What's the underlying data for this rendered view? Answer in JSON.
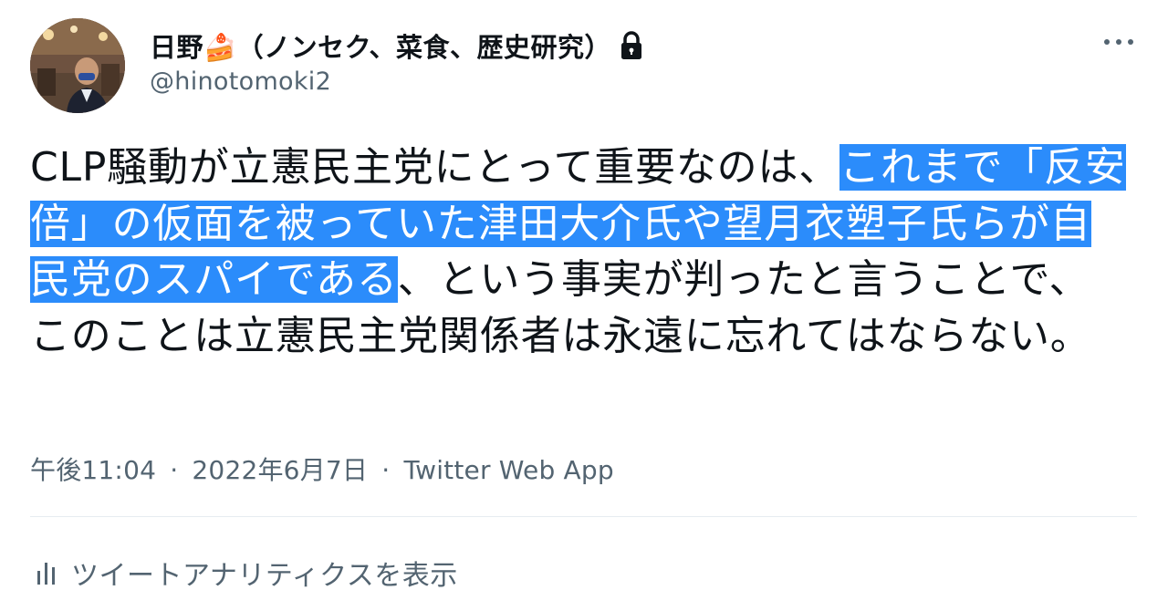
{
  "author": {
    "display_name": "日野🍰（ノンセク、菜食、歴史研究）",
    "handle": "@hinotomoki2",
    "protected_icon": "lock-icon",
    "avatar": "profile-photo"
  },
  "tweet": {
    "text_before": "CLP騒動が立憲民主党にとって重要なのは、",
    "text_highlighted": "これまで「反安倍」の仮面を被っていた津田大介氏や望月衣塑子氏らが自民党のスパイである",
    "text_after": "、という事実が判ったと言うことで、このことは立憲民主党関係者は永遠に忘れてはならない。",
    "time": "午後11:04",
    "date": "2022年6月7日",
    "separator": "·",
    "source": "Twitter Web App"
  },
  "actions": {
    "more_icon": "more-horizontal-icon",
    "analytics_label": "ツイートアナリティクスを表示",
    "analytics_icon": "bar-chart-icon"
  },
  "colors": {
    "highlight": "#2b8cfb",
    "secondary_text": "#536471",
    "primary_text": "#0f1419"
  }
}
